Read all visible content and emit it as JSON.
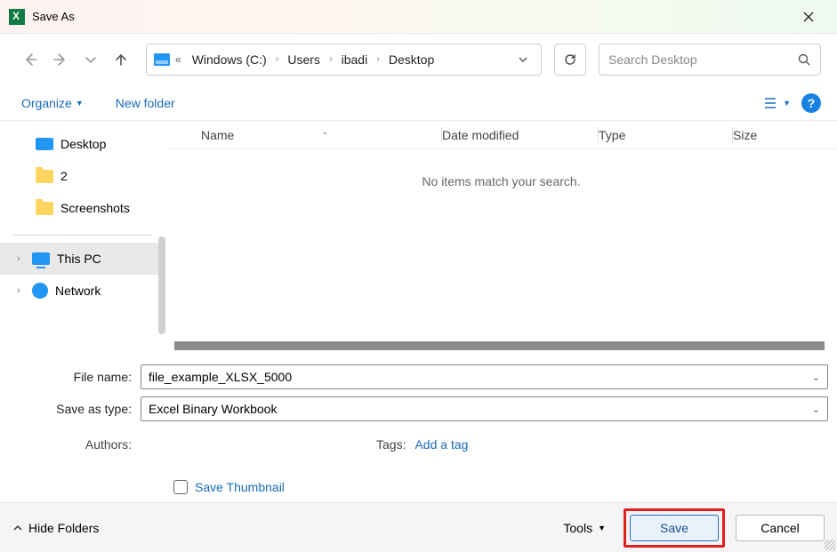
{
  "window": {
    "title": "Save As"
  },
  "breadcrumb": {
    "items": [
      "Windows (C:)",
      "Users",
      "ibadi",
      "Desktop"
    ]
  },
  "search": {
    "placeholder": "Search Desktop"
  },
  "toolbar": {
    "organize": "Organize",
    "new_folder": "New folder"
  },
  "sidebar": {
    "quick": [
      {
        "label": "Desktop",
        "icon": "desktop"
      },
      {
        "label": "2",
        "icon": "folder"
      },
      {
        "label": "Screenshots",
        "icon": "folder"
      }
    ],
    "roots": [
      {
        "label": "This PC",
        "icon": "pc",
        "selected": true
      },
      {
        "label": "Network",
        "icon": "net",
        "selected": false
      }
    ]
  },
  "columns": {
    "name": "Name",
    "date": "Date modified",
    "type": "Type",
    "size": "Size"
  },
  "list": {
    "empty_message": "No items match your search."
  },
  "form": {
    "filename_label": "File name:",
    "filename_value": "file_example_XLSX_5000",
    "savetype_label": "Save as type:",
    "savetype_value": "Excel Binary Workbook",
    "authors_label": "Authors:",
    "authors_value": "",
    "tags_label": "Tags:",
    "tags_link": "Add a tag",
    "thumbnail_label": "Save Thumbnail"
  },
  "footer": {
    "hide_folders": "Hide Folders",
    "tools": "Tools",
    "save": "Save",
    "cancel": "Cancel"
  }
}
